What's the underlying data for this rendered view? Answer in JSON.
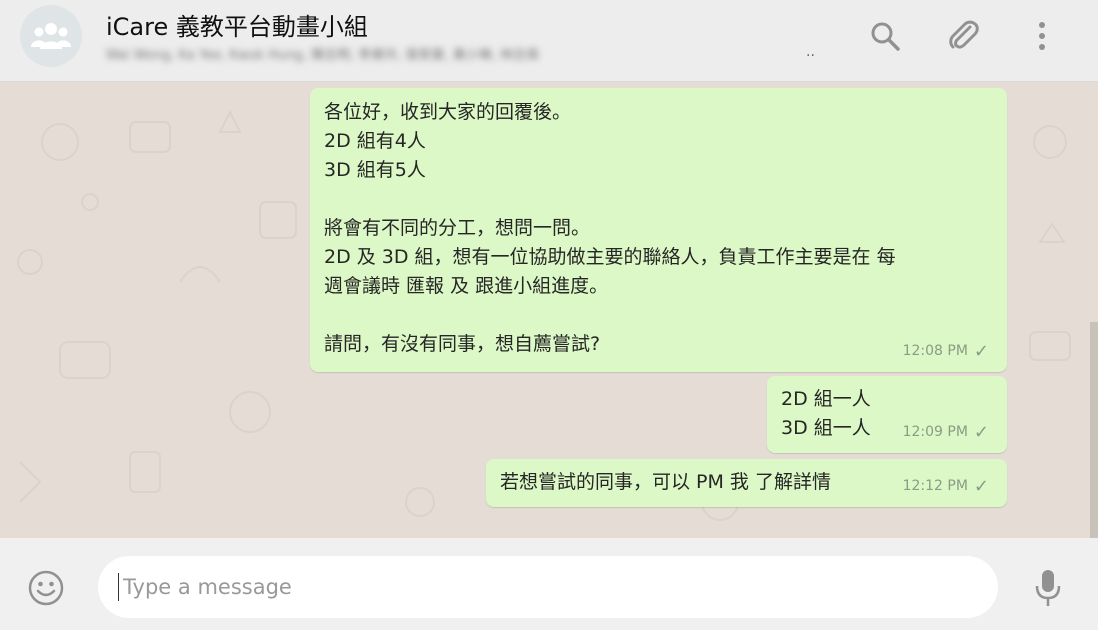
{
  "header": {
    "title": "iCare 義教平台動畫小組",
    "subtitle": "Wai Wong, Ka Yee, Kwok Hung, 陳志明, 李美玲, 張家豪, 黃小琳, 林志偉",
    "subtitle_ellipsis": "..",
    "icons": {
      "search": "search-icon",
      "attach": "paperclip-icon",
      "menu": "menu-dots-icon",
      "avatar": "group-avatar-icon"
    }
  },
  "messages": [
    {
      "text": "各位好，收到大家的回覆後。\n2D 組有4人\n3D 組有5人\n\n將會有不同的分工，想問一問。\n2D 及 3D 組，想有一位協助做主要的聯絡人，負責工作主要是在 每\n週會議時 匯報 及 跟進小組進度。\n\n請問，有沒有同事，想自薦嘗試?",
      "time": "12:08 PM",
      "status": "✓"
    },
    {
      "text": "2D 組一人\n3D 組一人",
      "time": "12:09 PM",
      "status": "✓"
    },
    {
      "text": "若想嘗試的同事，可以 PM 我 了解詳情",
      "time": "12:12 PM",
      "status": "✓"
    }
  ],
  "composer": {
    "placeholder": "Type a message",
    "icons": {
      "emoji": "emoji-icon",
      "mic": "microphone-icon"
    }
  },
  "colors": {
    "outgoing_bubble": "#dcf8c6",
    "chat_background": "#e5ddd5",
    "header_background": "#ededed",
    "icon_gray": "#919191"
  }
}
